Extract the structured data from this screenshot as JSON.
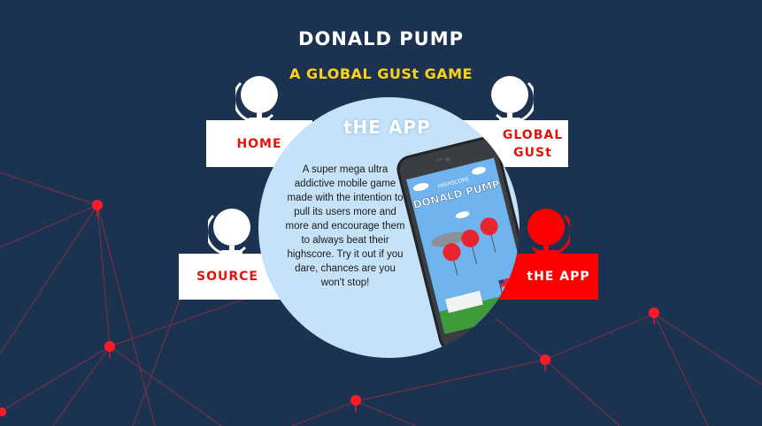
{
  "header": {
    "title": "DONALD PUMP",
    "subtitle": "A GLOBAL GUSt GAME"
  },
  "nav": {
    "home": "HOME",
    "global_gust": "GLOBAL GUSt",
    "source": "SOURCE",
    "the_app": "tHE APP"
  },
  "panel": {
    "title": "tHE APP",
    "description": "A super mega ultra addictive mobile game made with the intention to pull its users more and more and encourage them to always beat their highscore. Try it out if you dare, chances are you won't stop!"
  },
  "phone_screen": {
    "caption": "HIGHSCORE",
    "game_title": "DONALD PUMP"
  },
  "colors": {
    "background": "#1b3350",
    "accent_red": "#fe0000",
    "accent_yellow": "#ffd21a",
    "panel_blue": "#c5e2f8"
  }
}
